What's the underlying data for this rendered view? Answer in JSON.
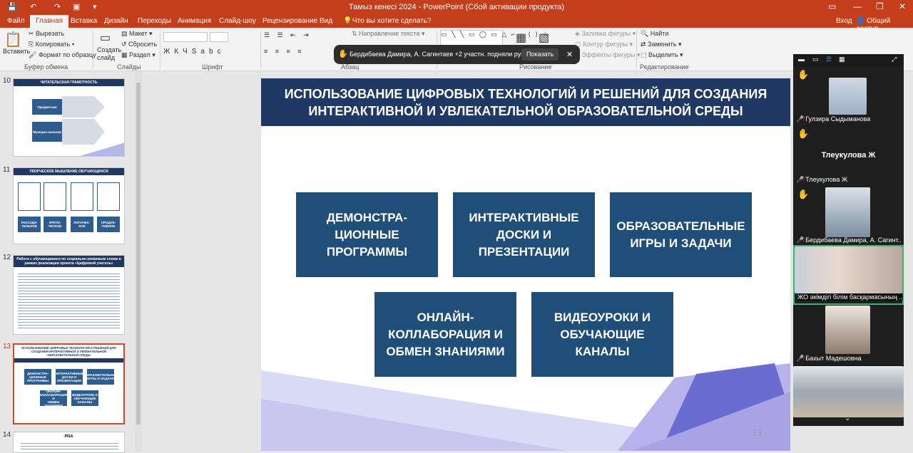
{
  "app": {
    "window_title": "Тамыз кенесі 2024 - PowerPoint (Сбой активации продукта)",
    "signin": "Вход",
    "share": "Общий доступ"
  },
  "tabs": [
    "Файл",
    "Главная",
    "Вставка",
    "Дизайн",
    "Переходы",
    "Анимация",
    "Слайд-шоу",
    "Рецензирование",
    "Вид"
  ],
  "tell_me": "Что вы хотите сделать?",
  "ribbon": {
    "clipboard": {
      "paste": "Вставить",
      "cut": "Вырезать",
      "copy": "Копировать",
      "format": "Формат по образцу",
      "label": "Буфер обмена"
    },
    "slides": {
      "new": "Создать слайд",
      "layout": "Макет",
      "reset": "Сбросить",
      "section": "Раздел",
      "label": "Слайды"
    },
    "font": {
      "label": "Шрифт"
    },
    "paragraph": {
      "direction": "Направление текста",
      "label": "Абзац"
    },
    "drawing": {
      "fill": "Заливка фигуры",
      "outline": "Контур фигуры",
      "effects": "Эффекты фигуры",
      "label": "Рисование"
    },
    "editing": {
      "find": "Найти",
      "replace": "Заменить",
      "select": "Выделить",
      "label": "Редактирование"
    }
  },
  "notification": {
    "text": "Бердибаева Дамира, А. Сагинтаев +2 участн. подняли руку",
    "button": "Показать"
  },
  "thumbnails": [
    {
      "num": "10",
      "title": "ЧИТАТЕЛЬСКАЯ ГРАМОТНОСТЬ",
      "items": [
        "Предметная",
        "Функцио-нальная"
      ]
    },
    {
      "num": "11",
      "title": "ТВОРЧЕСКОЕ МЫШЛЕНИЕ ОБУЧАЮЩИХСЯ",
      "items": [
        "РАССУДИ-ТЕЛЬНОЕ",
        "КРИТИ-ЧЕСКОЕ",
        "ЛОГИЧЕС-КОЕ",
        "ПРОДУК-ТИВНОЕ"
      ]
    },
    {
      "num": "12",
      "title": "Работа с обучающимися по социально-уязвимым слоям в рамках реализации проекта «Цифровой учитель»"
    },
    {
      "num": "13",
      "title": "ИСПОЛЬЗОВАНИЕ ЦИФРОВЫХ ТЕХНОЛОГИЙ И РЕШЕНИЙ ДЛЯ СОЗДАНИЯ ИНТЕРАКТИВНОЙ И УВЛЕКАТЕЛЬНОЙ ОБРАЗОВАТЕЛЬНОЙ СРЕДЫ"
    },
    {
      "num": "14",
      "title": "PISA"
    }
  ],
  "slide": {
    "title_line1": "ИСПОЛЬЗОВАНИЕ ЦИФРОВЫХ ТЕХНОЛОГИЙ И РЕШЕНИЙ ДЛЯ СОЗДАНИЯ",
    "title_line2": "ИНТЕРАКТИВНОЙ И УВЛЕКАТЕЛЬНОЙ ОБРАЗОВАТЕЛЬНОЙ СРЕДЫ",
    "cards": [
      [
        "ДЕМОНСТРА-",
        "ЦИОННЫЕ",
        "ПРОГРАММЫ"
      ],
      [
        "ИНТЕРАКТИВНЫЕ",
        "ДОСКИ И",
        "ПРЕЗЕНТАЦИИ"
      ],
      [
        "ОБРАЗОВАТЕЛЬНЫЕ",
        "ИГРЫ И ЗАДАЧИ"
      ],
      [
        "ОНЛАЙН-",
        "КОЛЛАБОРАЦИЯ И",
        "ОБМЕН ЗНАНИЯМИ"
      ],
      [
        "ВИДЕОУРОКИ И",
        "ОБУЧАЮЩИЕ",
        "КАНАЛЫ"
      ]
    ],
    "page_number": "13"
  },
  "participants": [
    {
      "name": "Гулзира Сыдыманова",
      "muted": true,
      "hand": true
    },
    {
      "name": "Тлеукулова Ж",
      "muted": true,
      "hand": true,
      "big_name": "Тлеукулова Ж"
    },
    {
      "name": "Бердибаева Дамира, А. Сагинт...",
      "muted": true,
      "hand": true
    },
    {
      "name": "ЖО әкімдігі білім басқармасының ...",
      "muted": false,
      "hand": false
    },
    {
      "name": "Бахыт Мадешовна",
      "muted": true,
      "hand": false
    },
    {
      "name": "",
      "muted": false,
      "hand": false
    }
  ],
  "colors": {
    "brand": "#c43e1c",
    "slide_header": "#1f3864",
    "card": "#1f4e79",
    "zoom_bg": "#1b1b1b",
    "active_speaker": "#3cb371"
  }
}
